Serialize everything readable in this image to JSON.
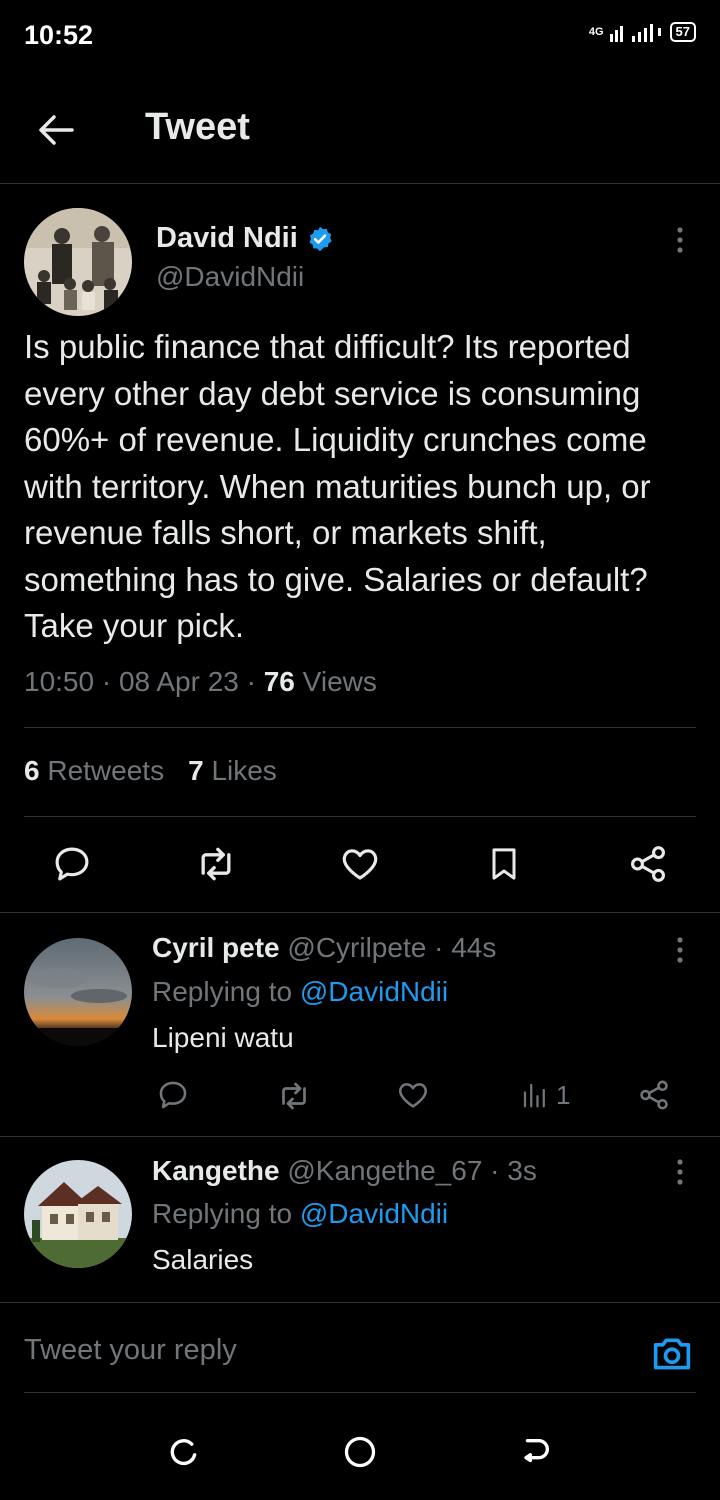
{
  "status_bar": {
    "time": "10:52",
    "network": "4G",
    "battery": "57"
  },
  "header": {
    "title": "Tweet"
  },
  "tweet": {
    "author_name": "David Ndii",
    "author_handle": "@DavidNdii",
    "text": "Is public finance that difficult? Its reported every other day debt service is consuming 60%+ of revenue. Liquidity crunches come with territory. When maturities bunch up, or revenue falls short, or markets shift, something has to give. Salaries or default? Take your pick.",
    "time": "10:50",
    "date": "08 Apr 23",
    "views_count": "76",
    "views_label": "Views",
    "retweets_count": "6",
    "retweets_label": "Retweets",
    "likes_count": "7",
    "likes_label": "Likes"
  },
  "replies": [
    {
      "name": "Cyril pete",
      "handle": "@Cyrilpete",
      "time": "44s",
      "replying_label": "Replying to",
      "replying_to": "@DavidNdii",
      "text": "Lipeni watu",
      "views": "1"
    },
    {
      "name": "Kangethe",
      "handle": "@Kangethe_67",
      "time": "3s",
      "replying_label": "Replying to",
      "replying_to": "@DavidNdii",
      "text": "Salaries"
    }
  ],
  "reply_box": {
    "placeholder": "Tweet your reply"
  },
  "icons": {
    "back": "arrow-left-icon",
    "verified": "verified-badge-icon",
    "reply": "comment-icon",
    "retweet": "retweet-icon",
    "like": "heart-icon",
    "bookmark": "bookmark-icon",
    "share": "share-icon",
    "views": "bar-chart-icon",
    "camera": "camera-icon"
  },
  "colors": {
    "background": "#000000",
    "accent": "#1d9bf0",
    "muted": "#71767b",
    "text": "#e7e9ea"
  }
}
